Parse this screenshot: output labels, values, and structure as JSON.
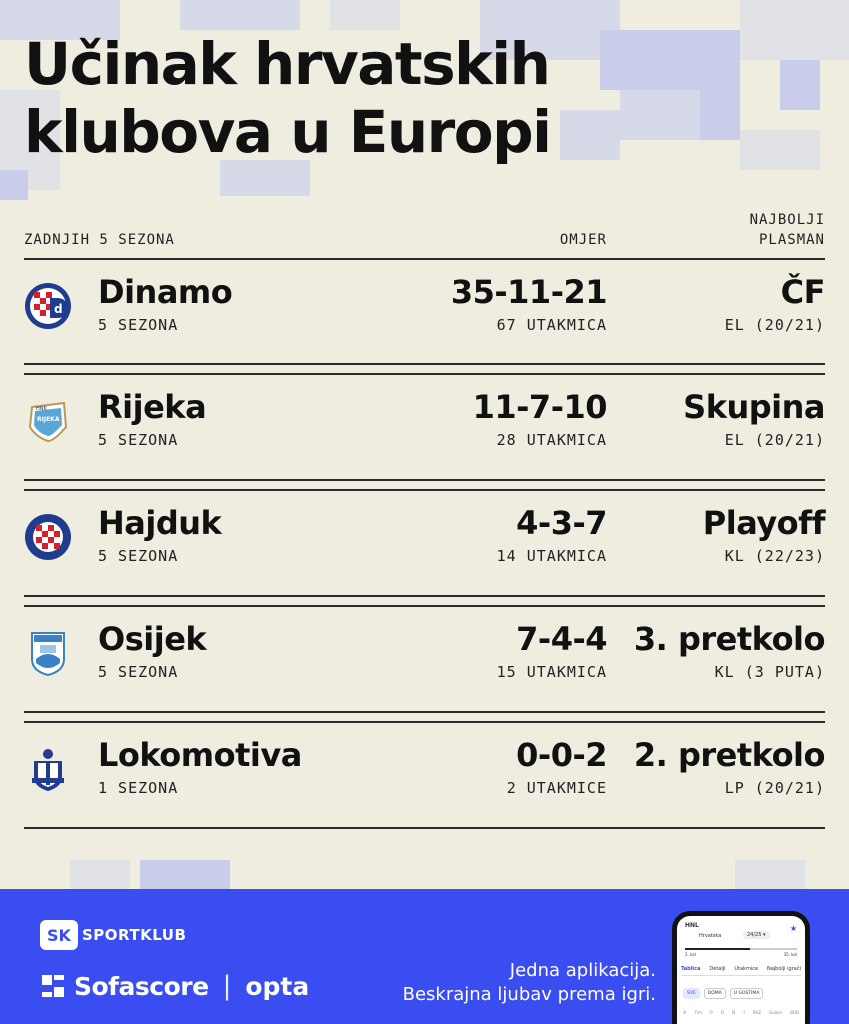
{
  "title": {
    "line1": "Učinak hrvatskih",
    "line2": "klubova u Europi"
  },
  "header": {
    "left": "ZADNJIH 5 SEZONA",
    "mid": "OMJER",
    "right_line1": "NAJBOLJI",
    "right_line2": "PLASMAN"
  },
  "clubs": [
    {
      "name": "Dinamo",
      "seasons": "5 SEZONA",
      "record": "35-11-21",
      "matches": "67 UTAKMICA",
      "best": "ČF",
      "comp": "EL (20/21)",
      "crest_icon": "dinamo-crest-icon"
    },
    {
      "name": "Rijeka",
      "seasons": "5 SEZONA",
      "record": "11-7-10",
      "matches": "28 UTAKMICA",
      "best": "Skupina",
      "comp": "EL (20/21)",
      "crest_icon": "rijeka-crest-icon"
    },
    {
      "name": "Hajduk",
      "seasons": "5 SEZONA",
      "record": "4-3-7",
      "matches": "14 UTAKMICA",
      "best": "Playoff",
      "comp": "KL (22/23)",
      "crest_icon": "hajduk-crest-icon"
    },
    {
      "name": "Osijek",
      "seasons": "5 SEZONA",
      "record": "7-4-4",
      "matches": "15 UTAKMICA",
      "best": "3. pretkolo",
      "comp": "KL (3 PUTA)",
      "crest_icon": "osijek-crest-icon"
    },
    {
      "name": "Lokomotiva",
      "seasons": "1 SEZONA",
      "record": "0-0-2",
      "matches": "2 UTAKMICE",
      "best": "2. pretkolo",
      "comp": "LP (20/21)",
      "crest_icon": "lokomotiva-crest-icon"
    }
  ],
  "footer": {
    "sk_mark": "SK",
    "sk_name": "SPORTKLUB",
    "sofascore": "Sofascore",
    "separator": "|",
    "opta": "opta",
    "tagline_line1": "Jedna aplikacija.",
    "tagline_line2": "Beskrajna ljubav prema igri."
  },
  "phone": {
    "league": "HNL",
    "country": "Hrvatska",
    "season": "24/25 ▾",
    "round_left": "2. kol",
    "round_right": "35. kol",
    "tabs": [
      "Tablica",
      "Detalji",
      "Utakmice",
      "Najbolji igrači"
    ],
    "chips": [
      "SVE",
      "DOMA",
      "U GOSTIMA"
    ],
    "cols": [
      "#",
      "Tim",
      "P",
      "D",
      "N",
      "I",
      "RAZ",
      "Golovi",
      "BOD"
    ]
  },
  "colors": {
    "background": "#efece0",
    "footer": "#3a4df0",
    "text": "#111111",
    "dinamo_blue": "#1f3c8f",
    "hajduk_red": "#d71f2a"
  }
}
